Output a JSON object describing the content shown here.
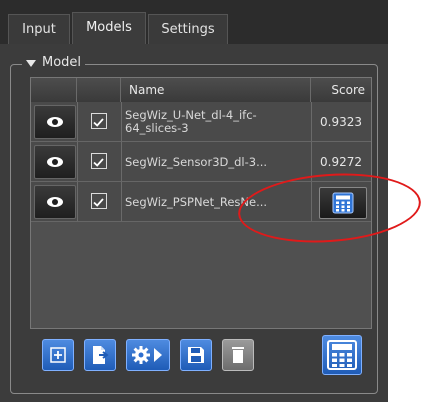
{
  "tabs": [
    {
      "label": "Input",
      "active": false
    },
    {
      "label": "Models",
      "active": true
    },
    {
      "label": "Settings",
      "active": false
    }
  ],
  "group": {
    "title": "Model",
    "expanded": true
  },
  "table": {
    "headers": {
      "visible": "",
      "enabled": "",
      "name": "Name",
      "score": "Score"
    },
    "rows": [
      {
        "name": "SegWiz_U-Net_dl-4_ifc-64_slices-3",
        "score": "0.9323",
        "visible": true,
        "checked": true
      },
      {
        "name": "SegWiz_Sensor3D_dl-3...",
        "score": "0.9272",
        "visible": true,
        "checked": true
      },
      {
        "name": "SegWiz_PSPNet_ResNe...",
        "score": "",
        "visible": true,
        "checked": true,
        "score_button": "calculator-icon"
      }
    ]
  },
  "toolbar": {
    "buttons": [
      {
        "icon": "add-model-icon"
      },
      {
        "icon": "export-model-icon"
      },
      {
        "icon": "gear-arrow-icon"
      },
      {
        "icon": "save-icon"
      },
      {
        "icon": "trash-icon"
      }
    ],
    "compute_button_icon": "calculator-icon"
  },
  "annotation": {
    "color": "#e01a1a",
    "shape": "ellipse"
  }
}
